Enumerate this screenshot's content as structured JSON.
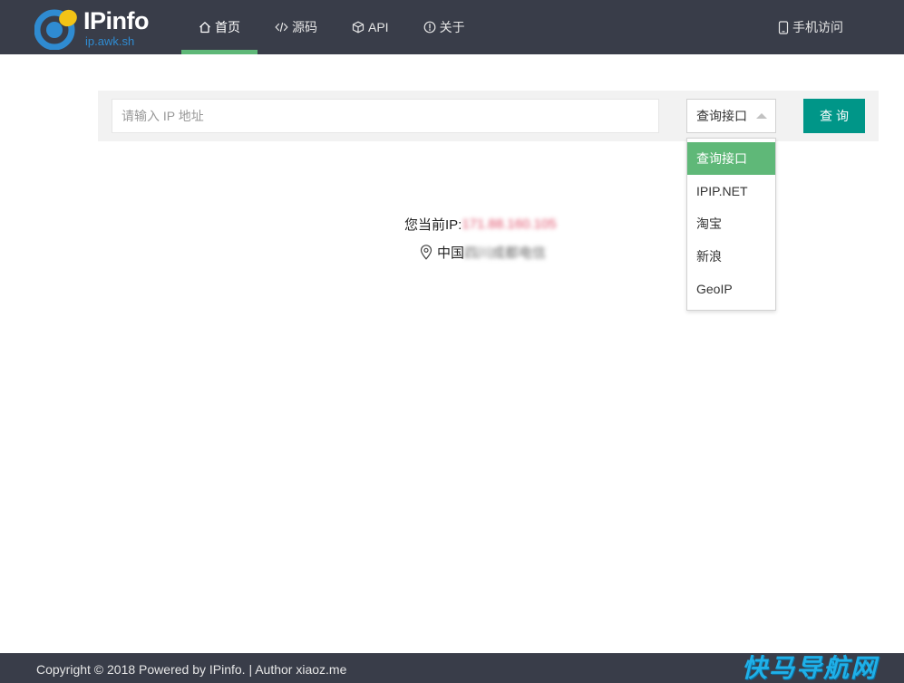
{
  "header": {
    "logo_title": "IPinfo",
    "logo_subtitle": "ip.awk.sh",
    "nav": [
      {
        "label": "首页",
        "icon": "home-icon",
        "active": true
      },
      {
        "label": "源码",
        "icon": "code-icon",
        "active": false
      },
      {
        "label": "API",
        "icon": "cube-icon",
        "active": false
      },
      {
        "label": "关于",
        "icon": "info-icon",
        "active": false
      }
    ],
    "mobile_label": "手机访问",
    "mobile_icon": "mobile-phone-icon"
  },
  "search": {
    "placeholder": "请输入 IP 地址",
    "value": "",
    "select_value": "查询接口",
    "button_label": "查询"
  },
  "dropdown": {
    "options": [
      "查询接口",
      "IPIP.NET",
      "淘宝",
      "新浪",
      "GeoIP"
    ],
    "selected_index": 0
  },
  "current": {
    "ip_label": "您当前IP:",
    "ip_value": "171.88.160.105",
    "location_prefix": "中国",
    "location_value": "四川成都电信",
    "location_icon": "map-pin-icon"
  },
  "footer": {
    "text": "Copyright © 2018 Powered by IPinfo. | Author xiaoz.me"
  },
  "watermark": {
    "text": "快马导航网"
  },
  "colors": {
    "header_bg": "#393d49",
    "accent_green": "#5fb878",
    "button_teal": "#009688",
    "logo_blue": "#2f8bd1",
    "logo_yellow": "#f2c316"
  }
}
